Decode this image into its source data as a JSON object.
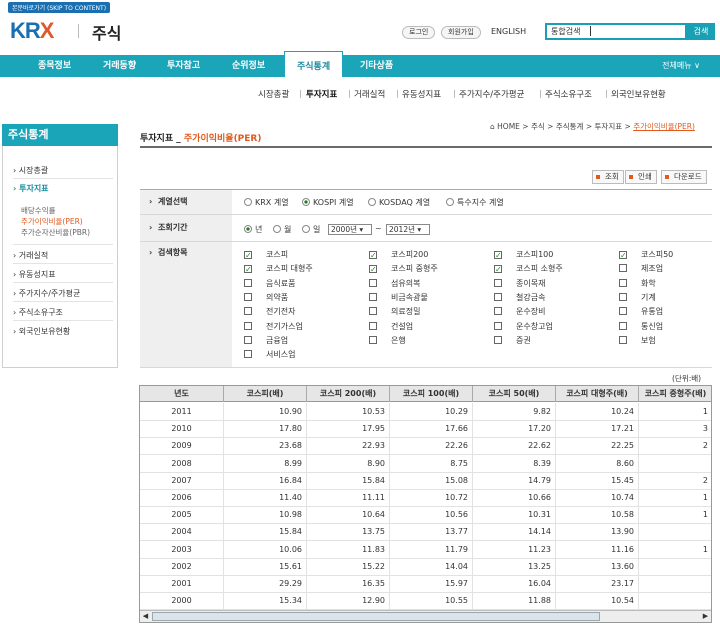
{
  "header": {
    "skip_link": "본문바로가기 (SKIP TO CONTENT)",
    "logo_k": "KR",
    "logo_x": "X",
    "site_title": "주식",
    "login": "로그인",
    "join": "회원가입",
    "lang": "ENGLISH",
    "search_placeholder": "통합검색",
    "search_button": "검색"
  },
  "nav": {
    "items": [
      "종목정보",
      "거래동향",
      "투자참고",
      "순위정보",
      "주식통계",
      "기타상품"
    ],
    "active": "주식통계",
    "all_menu": "전체메뉴 ∨"
  },
  "subnav": [
    "시장총괄",
    "투자지표",
    "거래실적",
    "유동성지표",
    "주가지수/주가평균",
    "주식소유구조",
    "외국인보유현황"
  ],
  "sidebar": {
    "title": "주식통계",
    "items": [
      "시장총괄",
      "투자지표",
      "거래실적",
      "유동성지표",
      "주가지수/주가평균",
      "주식소유구조",
      "외국인보유현황"
    ],
    "subitems": [
      "배당수익률",
      "주가이익비율(PER)",
      "주가순자산비율(PBR)"
    ]
  },
  "page": {
    "title_prefix": "투자지표 _ ",
    "title_main": "주가이익비율(PER)",
    "breadcrumb": [
      "HOME",
      "주식",
      "주식통계",
      "투자지표"
    ],
    "breadcrumb_current": "주가이익비율(PER)",
    "actions": [
      "조회",
      "인쇄",
      "다운로드"
    ]
  },
  "form": {
    "label_series": "계열선택",
    "series_options": [
      "KRX 계열",
      "KOSPI 계열",
      "KOSDAQ 계열",
      "특수지수 계열"
    ],
    "series_selected": "KOSPI 계열",
    "label_period": "조회기간",
    "period_options": [
      "년",
      "월",
      "일"
    ],
    "period_selected": "년",
    "year_from": "2000년",
    "tilde": "~",
    "year_to": "2012년",
    "label_items": "검색항목",
    "items": [
      {
        "label": "코스피",
        "checked": true
      },
      {
        "label": "코스피200",
        "checked": true
      },
      {
        "label": "코스피100",
        "checked": true
      },
      {
        "label": "코스피50",
        "checked": true
      },
      {
        "label": "코스피 대형주",
        "checked": true
      },
      {
        "label": "코스피 중형주",
        "checked": true
      },
      {
        "label": "코스피 소형주",
        "checked": true
      },
      {
        "label": "제조업",
        "checked": false
      },
      {
        "label": "음식료품",
        "checked": false
      },
      {
        "label": "섬유의복",
        "checked": false
      },
      {
        "label": "종이목재",
        "checked": false
      },
      {
        "label": "화학",
        "checked": false
      },
      {
        "label": "의약품",
        "checked": false
      },
      {
        "label": "비금속광물",
        "checked": false
      },
      {
        "label": "철강금속",
        "checked": false
      },
      {
        "label": "기계",
        "checked": false
      },
      {
        "label": "전기전자",
        "checked": false
      },
      {
        "label": "의료정밀",
        "checked": false
      },
      {
        "label": "운수장비",
        "checked": false
      },
      {
        "label": "유통업",
        "checked": false
      },
      {
        "label": "전기가스업",
        "checked": false
      },
      {
        "label": "건설업",
        "checked": false
      },
      {
        "label": "운수창고업",
        "checked": false
      },
      {
        "label": "통신업",
        "checked": false
      },
      {
        "label": "금융업",
        "checked": false
      },
      {
        "label": "은행",
        "checked": false
      },
      {
        "label": "증권",
        "checked": false
      },
      {
        "label": "보험",
        "checked": false
      },
      {
        "label": "서비스업",
        "checked": false
      }
    ]
  },
  "table": {
    "unit": "(단위:배)",
    "columns": [
      "년도",
      "코스피(배)",
      "코스피 200(배)",
      "코스피 100(배)",
      "코스피 50(배)",
      "코스피 대형주(배)",
      "코스피 중형주(배)"
    ],
    "rows": [
      [
        "2011",
        "10.90",
        "10.53",
        "10.29",
        "9.82",
        "10.24",
        "1"
      ],
      [
        "2010",
        "17.80",
        "17.95",
        "17.66",
        "17.20",
        "17.21",
        "3"
      ],
      [
        "2009",
        "23.68",
        "22.93",
        "22.26",
        "22.62",
        "22.25",
        "2"
      ],
      [
        "2008",
        "8.99",
        "8.90",
        "8.75",
        "8.39",
        "8.60",
        ""
      ],
      [
        "2007",
        "16.84",
        "15.84",
        "15.08",
        "14.79",
        "15.45",
        "2"
      ],
      [
        "2006",
        "11.40",
        "11.11",
        "10.72",
        "10.66",
        "10.74",
        "1"
      ],
      [
        "2005",
        "10.98",
        "10.64",
        "10.56",
        "10.31",
        "10.58",
        "1"
      ],
      [
        "2004",
        "15.84",
        "13.75",
        "13.77",
        "14.14",
        "13.90",
        ""
      ],
      [
        "2003",
        "10.06",
        "11.83",
        "11.79",
        "11.23",
        "11.16",
        "1"
      ],
      [
        "2002",
        "15.61",
        "15.22",
        "14.04",
        "13.25",
        "13.60",
        ""
      ],
      [
        "2001",
        "29.29",
        "16.35",
        "15.97",
        "16.04",
        "23.17",
        ""
      ],
      [
        "2000",
        "15.34",
        "12.90",
        "10.55",
        "11.88",
        "10.54",
        ""
      ]
    ]
  }
}
